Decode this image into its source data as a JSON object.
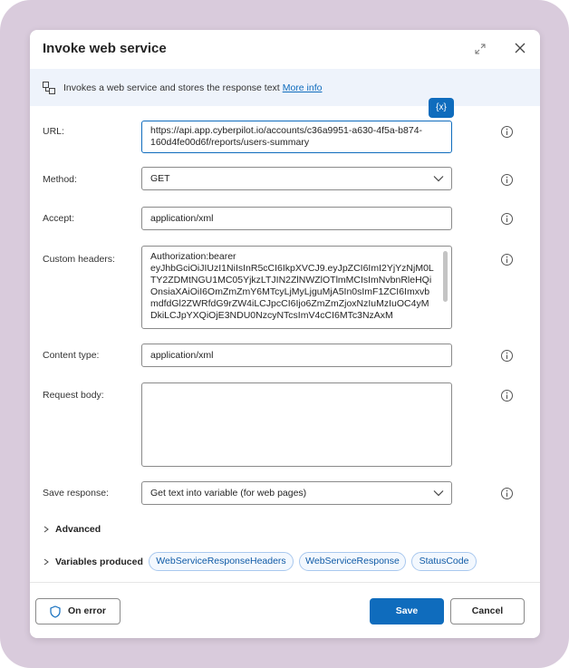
{
  "dialog": {
    "title": "Invoke web service",
    "description": "Invokes a web service and stores the response text",
    "more_info": "More info",
    "variable_button": "{x}"
  },
  "fields": {
    "url": {
      "label": "URL:",
      "value": "https://api.app.cyberpilot.io/accounts/c36a9951-a630-4f5a-b874-160d4fe00d6f/reports/users-summary"
    },
    "method": {
      "label": "Method:",
      "value": "GET"
    },
    "accept": {
      "label": "Accept:",
      "value": "application/xml"
    },
    "custom_headers": {
      "label": "Custom headers:",
      "value": "Authorization:bearer\neyJhbGciOiJIUzI1NiIsInR5cCI6IkpXVCJ9.eyJpZCI6ImI2YjYzNjM0LTY2ZDMtNGU1MC05YjkzLTJIN2ZlNWZlOTlmMCIsImNvbnRleHQiOnsiaXAiOiI6OmZmZmY6MTcyLjMyLjguMjA5In0sImF1ZCI6ImxvbmdfdGl2ZWRfdG9rZW4iLCJpcCI6Ijo6ZmZmZjoxNzIuMzIuOC4yMDkiLCJpYXQiOjE3NDU0NzcyNTcsImV4cCI6MTc3NzAxM"
    },
    "content_type": {
      "label": "Content type:",
      "value": "application/xml"
    },
    "request_body": {
      "label": "Request body:",
      "value": ""
    },
    "save_response": {
      "label": "Save response:",
      "value": "Get text into variable (for web pages)"
    }
  },
  "sections": {
    "advanced": "Advanced",
    "variables_produced": "Variables produced"
  },
  "variables": [
    "WebServiceResponseHeaders",
    "WebServiceResponse",
    "StatusCode"
  ],
  "footer": {
    "on_error": "On error",
    "save": "Save",
    "cancel": "Cancel"
  },
  "colors": {
    "accent": "#0f6cbd",
    "backdrop": "#d9cbdc",
    "banner": "#eef3fb"
  }
}
